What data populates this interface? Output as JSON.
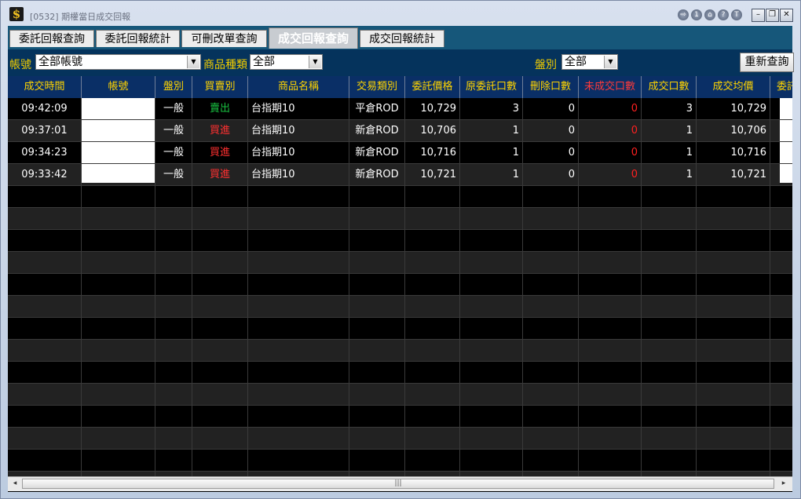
{
  "window": {
    "title": "[0532] 期權當日成交回報"
  },
  "titlebar_buttons": [
    "⇨",
    "1",
    "⌂",
    "?",
    "T"
  ],
  "window_controls": {
    "minimize": "–",
    "restore": "❐",
    "close": "✕"
  },
  "tabs": [
    {
      "label": "委託回報查詢"
    },
    {
      "label": "委託回報統計"
    },
    {
      "label": "可刪改單查詢"
    },
    {
      "label": "成交回報查詢",
      "active": true
    },
    {
      "label": "成交回報統計"
    }
  ],
  "filters": {
    "account_label": "帳號",
    "account_value": "全部帳號",
    "product_type_label": "商品種類",
    "product_type_value": "全部",
    "session_label": "盤別",
    "session_value": "全部",
    "requery_label": "重新查詢"
  },
  "table": {
    "headers": [
      "成交時間",
      "帳號",
      "盤別",
      "買賣別",
      "商品名稱",
      "交易類別",
      "委託價格",
      "原委託口數",
      "刪除口數",
      "未成交口數",
      "成交口數",
      "成交均價",
      "委託"
    ],
    "rows": [
      {
        "time": "09:42:09",
        "account": "",
        "session": "一般",
        "side": "賣出",
        "product": "台指期10",
        "trade_type": "平倉ROD",
        "price": "10,729",
        "orig_qty": "3",
        "cancel_qty": "0",
        "unfilled_qty": "0",
        "filled_qty": "3",
        "avg_price": "10,729"
      },
      {
        "time": "09:37:01",
        "account": "",
        "session": "一般",
        "side": "買進",
        "product": "台指期10",
        "trade_type": "新倉ROD",
        "price": "10,706",
        "orig_qty": "1",
        "cancel_qty": "0",
        "unfilled_qty": "0",
        "filled_qty": "1",
        "avg_price": "10,706"
      },
      {
        "time": "09:34:23",
        "account": "",
        "session": "一般",
        "side": "買進",
        "product": "台指期10",
        "trade_type": "新倉ROD",
        "price": "10,716",
        "orig_qty": "1",
        "cancel_qty": "0",
        "unfilled_qty": "0",
        "filled_qty": "1",
        "avg_price": "10,716"
      },
      {
        "time": "09:33:42",
        "account": "",
        "session": "一般",
        "side": "買進",
        "product": "台指期10",
        "trade_type": "新倉ROD",
        "price": "10,721",
        "orig_qty": "1",
        "cancel_qty": "0",
        "unfilled_qty": "0",
        "filled_qty": "1",
        "avg_price": "10,721"
      }
    ]
  },
  "colors": {
    "header_text": "#ffd400",
    "unfilled_header": "#ff3a3a",
    "sell": "#18c040",
    "buy": "#ff3030"
  },
  "scrollbar": {
    "left_arrow": "◂",
    "right_arrow": "▸",
    "grip": "|||"
  }
}
